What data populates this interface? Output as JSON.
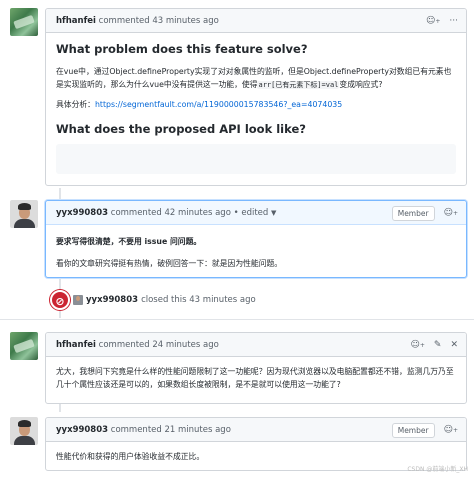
{
  "comments": [
    {
      "author": "hfhanfei",
      "meta": "commented 43 minutes ago",
      "heading1": "What problem does this feature solve?",
      "para1_a": "在vue中，通过Object.defineProperty实现了对对象属性的监听，但是Object.defineProperty对数组已有元素也是实现监听的，那么为什么vue中没有提供这一功能，使得",
      "code": "arr[已有元素下标]=val",
      "para1_b": "变成响应式?",
      "analysis_label": "具体分析：",
      "analysis_link": "https://segmentfault.com/a/1190000015783546?_ea=4074035",
      "heading2": "What does the proposed API look like?"
    },
    {
      "author": "yyx990803",
      "meta": "commented 42 minutes ago",
      "edited": "• edited",
      "badge": "Member",
      "strong": "要求写得很清楚，不要用 issue 问问题。",
      "text": "看你的文章研究得挺有热情，破例回答一下：就是因为性能问题。"
    },
    {
      "author": "hfhanfei",
      "meta": "commented 24 minutes ago",
      "text": "尤大，我想问下究竟是什么样的性能问题限制了这一功能呢？因为现代浏览器以及电脑配置都还不错，监测几万乃至几十个属性应该还是可以的，如果数组长度被限制，是不是就可以使用这一功能了?"
    },
    {
      "author": "yyx990803",
      "meta": "commented 21 minutes ago",
      "badge": "Member",
      "text": "性能代价和获得的用户体验收益不成正比。"
    }
  ],
  "closed_event": {
    "user": "yyx990803",
    "text": "closed this 43 minutes ago"
  },
  "watermark": "CSDN @前端小新_XH"
}
